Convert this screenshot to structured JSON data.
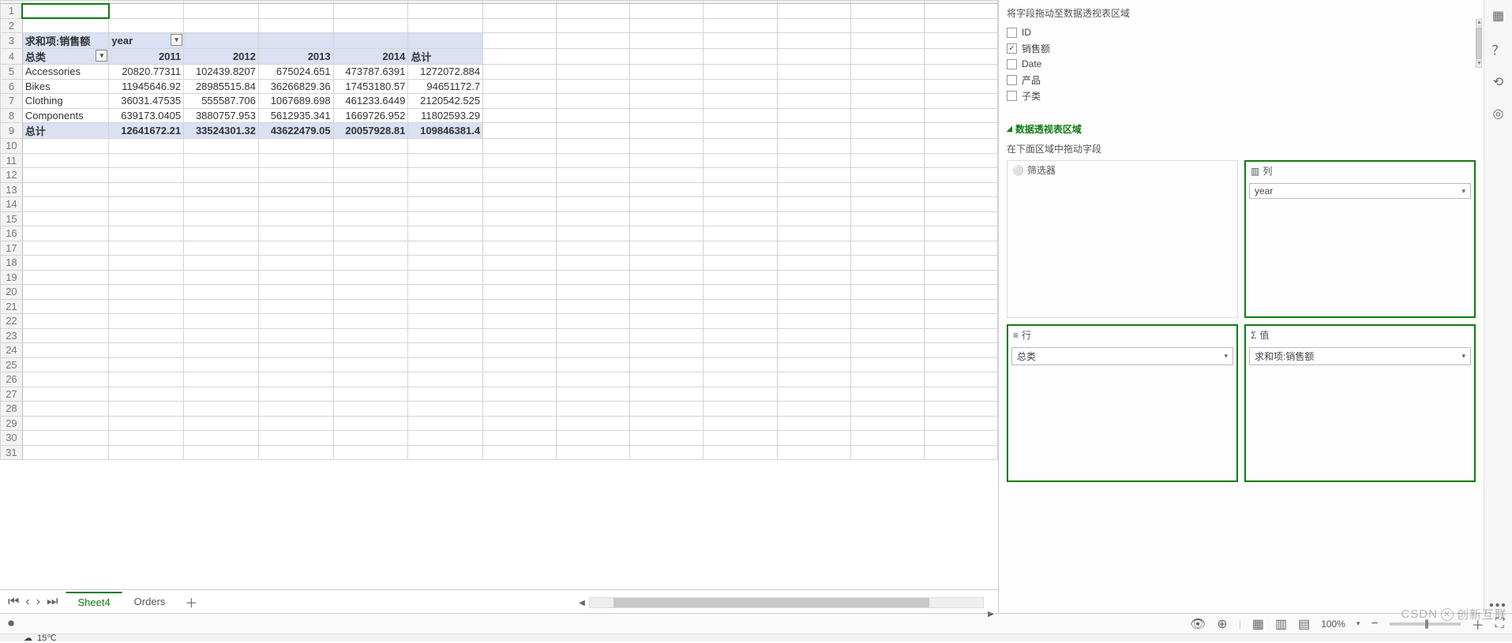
{
  "pivot": {
    "corner_label": "求和项:销售额",
    "col_field": "year",
    "row_dropdown_label": "总类",
    "columns": [
      "2011",
      "2012",
      "2013",
      "2014"
    ],
    "grand_col": "总计",
    "rows": [
      {
        "label": "Accessories",
        "vals": [
          "20820.77311",
          "102439.8207",
          "675024.651",
          "473787.6391"
        ],
        "tot": "1272072.884"
      },
      {
        "label": "Bikes",
        "vals": [
          "11945646.92",
          "28985515.84",
          "36266829.36",
          "17453180.57"
        ],
        "tot": "94651172.7"
      },
      {
        "label": "Clothing",
        "vals": [
          "36031.47535",
          "555587.706",
          "1067689.698",
          "461233.6449"
        ],
        "tot": "2120542.525"
      },
      {
        "label": "Components",
        "vals": [
          "639173.0405",
          "3880757.953",
          "5612935.341",
          "1669726.952"
        ],
        "tot": "11802593.29"
      }
    ],
    "grand_row_label": "总计",
    "grand_row": [
      "12641672.21",
      "33524301.32",
      "43622479.05",
      "20057928.81"
    ],
    "grand_total": "109846381.4"
  },
  "row_numbers": [
    1,
    2,
    3,
    4,
    5,
    6,
    7,
    8,
    9,
    10,
    11,
    12,
    13,
    14,
    15,
    16,
    17,
    18,
    19,
    20,
    21,
    22,
    23,
    24,
    25,
    26,
    27,
    28,
    29,
    30,
    31
  ],
  "sheet_tabs": {
    "active": "Sheet4",
    "other": "Orders"
  },
  "panel": {
    "drag_hint": "将字段拖动至数据透视表区域",
    "fields": [
      {
        "name": "ID",
        "checked": false
      },
      {
        "name": "销售额",
        "checked": true
      },
      {
        "name": "Date",
        "checked": false
      },
      {
        "name": "产品",
        "checked": false
      },
      {
        "name": "子类",
        "checked": false
      }
    ],
    "section_title": "数据透视表区域",
    "area_hint": "在下面区域中拖动字段",
    "areas": {
      "filter": {
        "label": "筛选器",
        "items": []
      },
      "column": {
        "label": "列",
        "items": [
          "year"
        ]
      },
      "row": {
        "label": "行",
        "items": [
          "总类"
        ]
      },
      "value": {
        "label": "值",
        "items": [
          "求和项:销售额"
        ]
      }
    }
  },
  "status": {
    "zoom": "100%",
    "temp": "15℃"
  },
  "watermark": {
    "brand1": "CSDN",
    "brand2": "创新互联"
  },
  "chart_data": {
    "type": "table",
    "title": "求和项:销售额 by 总类 × year",
    "columns": [
      "2011",
      "2012",
      "2013",
      "2014",
      "总计"
    ],
    "rows": [
      "Accessories",
      "Bikes",
      "Clothing",
      "Components",
      "总计"
    ],
    "values": [
      [
        20820.77311,
        102439.8207,
        675024.651,
        473787.6391,
        1272072.884
      ],
      [
        11945646.92,
        28985515.84,
        36266829.36,
        17453180.57,
        94651172.7
      ],
      [
        36031.47535,
        555587.706,
        1067689.698,
        461233.6449,
        2120542.525
      ],
      [
        639173.0405,
        3880757.953,
        5612935.341,
        1669726.952,
        11802593.29
      ],
      [
        12641672.21,
        33524301.32,
        43622479.05,
        20057928.81,
        109846381.4
      ]
    ]
  }
}
